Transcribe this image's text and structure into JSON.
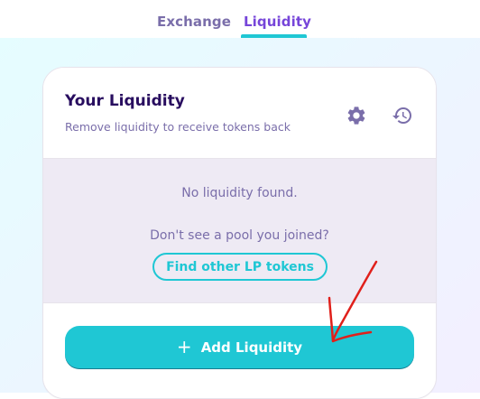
{
  "nav": {
    "tabs": [
      {
        "label": "Exchange",
        "active": false
      },
      {
        "label": "Liquidity",
        "active": true
      }
    ]
  },
  "card": {
    "title": "Your Liquidity",
    "subtitle": "Remove liquidity to receive tokens back",
    "icons": [
      "gear-icon",
      "history-icon"
    ],
    "empty_text": "No liquidity found.",
    "hint_text": "Don't see a pool you joined?",
    "find_button_label": "Find other LP tokens",
    "add_button_label": "Add Liquidity",
    "add_button_icon": "+"
  },
  "colors": {
    "primary": "#1fc7d4",
    "secondary": "#7645d9",
    "text": "#280d5f",
    "text_subtle": "#7a6eaa",
    "annotation": "#e0201b"
  }
}
